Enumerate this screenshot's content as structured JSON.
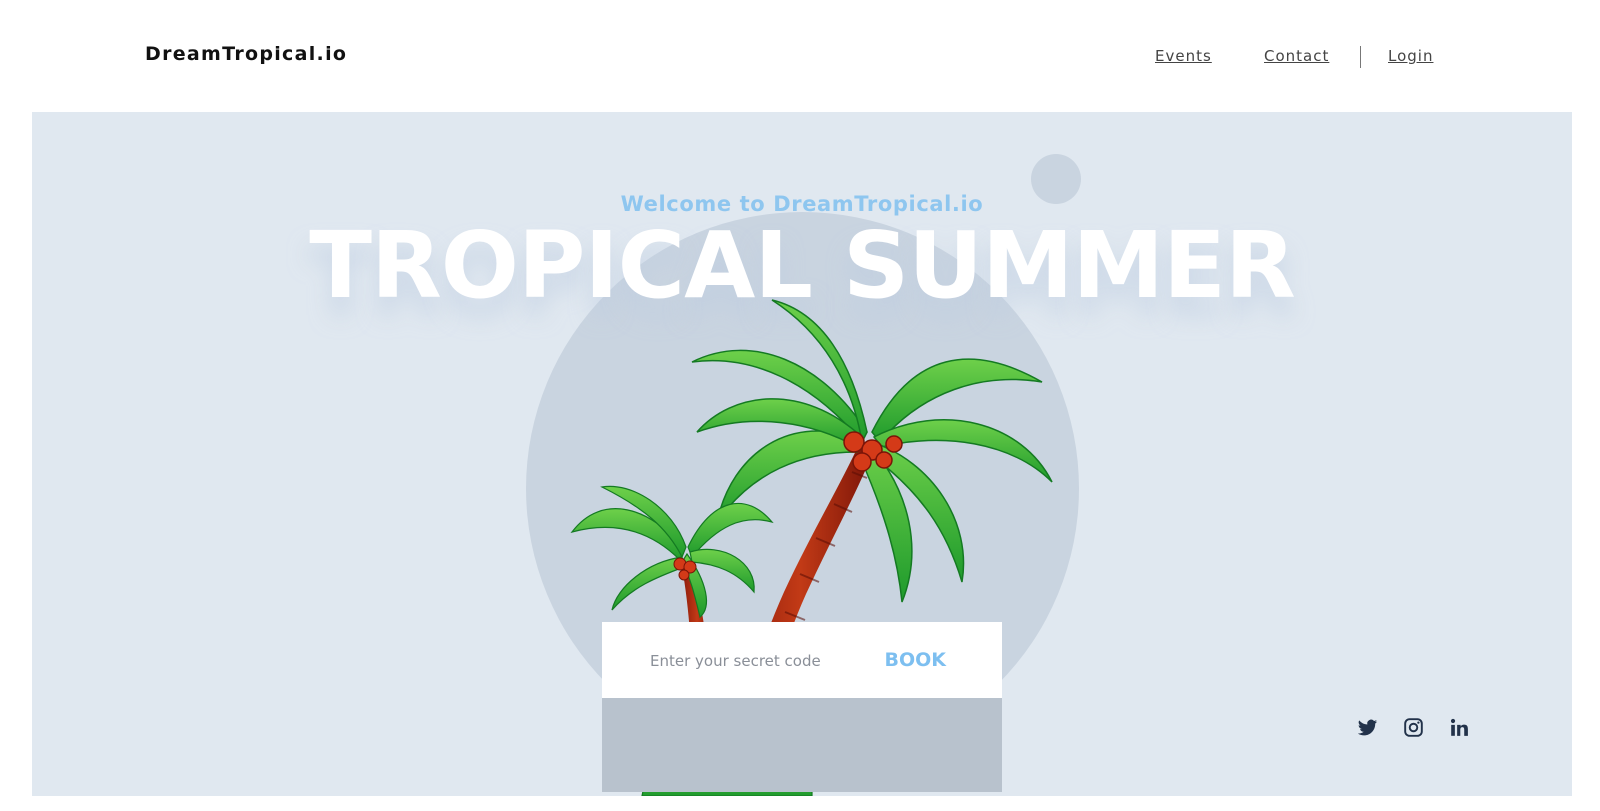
{
  "header": {
    "brand": "DreamTropical.io",
    "nav": {
      "events": "Events",
      "contact": "Contact",
      "login": "Login"
    }
  },
  "hero": {
    "welcome": "Welcome to DreamTropical.io",
    "title": "TROPICAL SUMMER",
    "booking": {
      "placeholder": "Enter your secret code",
      "value": "",
      "button_label": "BOOK"
    }
  },
  "socials": [
    {
      "icon": "twitter-icon"
    },
    {
      "icon": "instagram-icon"
    },
    {
      "icon": "linkedin-icon"
    }
  ],
  "colors": {
    "hero_background": "#e0e8f0",
    "circle": "#c9d4e0",
    "accent": "#7dbff0",
    "title": "#ffffff",
    "social_icons": "#22324a"
  }
}
